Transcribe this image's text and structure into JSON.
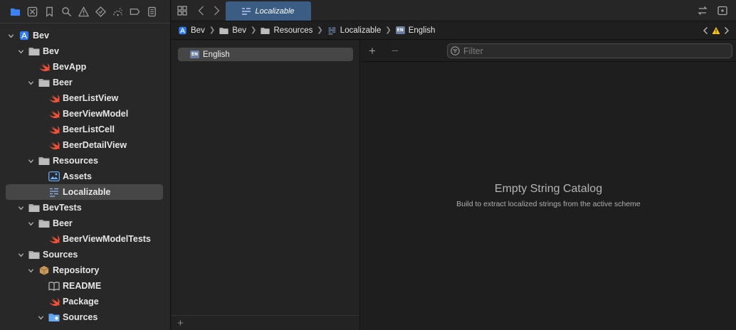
{
  "colors": {
    "accent": "#3a82f6",
    "swift_orange": "#f05138",
    "folder_gray": "#aaaaaa",
    "tab_blue": "#3b5c83"
  },
  "navigator": {
    "toolbar_icons": [
      "project-navigator-icon",
      "source-control-icon",
      "bookmark-icon",
      "find-icon",
      "issue-warning-icon",
      "test-icon",
      "debug-icon",
      "breakpoint-icon",
      "report-icon"
    ],
    "tree": [
      {
        "label": "Bev",
        "icon": "xcode-project-icon",
        "level": 0,
        "expanded": true,
        "bold": true
      },
      {
        "label": "Bev",
        "icon": "folder-icon",
        "level": 1,
        "expanded": true,
        "bold": true
      },
      {
        "label": "BevApp",
        "icon": "swift-icon",
        "level": 2,
        "bold": true
      },
      {
        "label": "Beer",
        "icon": "folder-icon",
        "level": 2,
        "expanded": true,
        "bold": true
      },
      {
        "label": "BeerListView",
        "icon": "swift-icon",
        "level": 3,
        "bold": true
      },
      {
        "label": "BeerViewModel",
        "icon": "swift-icon",
        "level": 3,
        "bold": true
      },
      {
        "label": "BeerListCell",
        "icon": "swift-icon",
        "level": 3,
        "bold": true
      },
      {
        "label": "BeerDetailView",
        "icon": "swift-icon",
        "level": 3,
        "bold": true
      },
      {
        "label": "Resources",
        "icon": "folder-icon",
        "level": 2,
        "expanded": true,
        "bold": true
      },
      {
        "label": "Assets",
        "icon": "asset-catalog-icon",
        "level": 3,
        "bold": true
      },
      {
        "label": "Localizable",
        "icon": "string-catalog-icon",
        "level": 3,
        "bold": true,
        "selected": true
      },
      {
        "label": "BevTests",
        "icon": "folder-icon",
        "level": 1,
        "expanded": true,
        "bold": true
      },
      {
        "label": "Beer",
        "icon": "folder-icon",
        "level": 2,
        "expanded": true,
        "bold": true
      },
      {
        "label": "BeerViewModelTests",
        "icon": "swift-icon",
        "level": 3,
        "bold": true
      },
      {
        "label": "Sources",
        "icon": "folder-icon",
        "level": 1,
        "expanded": true,
        "bold": true
      },
      {
        "label": "Repository",
        "icon": "package-icon",
        "level": 2,
        "expanded": true,
        "bold": true
      },
      {
        "label": "README",
        "icon": "book-icon",
        "level": 3,
        "bold": true
      },
      {
        "label": "Package",
        "icon": "swift-icon",
        "level": 3,
        "bold": true
      },
      {
        "label": "Sources",
        "icon": "folder-link-icon",
        "level": 3,
        "expanded": true,
        "bold": true
      }
    ]
  },
  "editor": {
    "tab_title": "Localizable",
    "breadcrumbs": [
      {
        "label": "Bev",
        "icon": "xcode-project-icon"
      },
      {
        "label": "Bev",
        "icon": "folder-icon"
      },
      {
        "label": "Resources",
        "icon": "folder-icon"
      },
      {
        "label": "Localizable",
        "icon": "string-catalog-icon"
      },
      {
        "label": "English",
        "icon": "en-badge-icon"
      }
    ],
    "en_badge": "EN",
    "languages": [
      {
        "label": "English",
        "badge": "EN"
      }
    ],
    "add_language_label": "+",
    "add_button": "+",
    "remove_button": "−",
    "filter_placeholder": "Filter",
    "empty_title": "Empty String Catalog",
    "empty_subtitle": "Build to extract localized strings from the active scheme"
  }
}
